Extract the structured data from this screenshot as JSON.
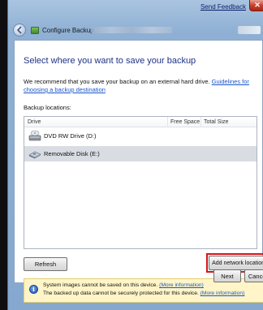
{
  "window": {
    "title": "Configure Backup",
    "send_feedback": "Send Feedback",
    "close_symbol": "✕"
  },
  "page": {
    "heading": "Select where you want to save your backup",
    "recommend_text": "We recommend that you save your backup on an external hard drive. ",
    "recommend_link": "Guidelines for choosing a backup destination",
    "locations_label": "Backup locations:"
  },
  "list": {
    "columns": [
      "Drive",
      "Free Space",
      "Total Size"
    ],
    "rows": [
      {
        "label": "DVD RW Drive (D:)",
        "icon": "dvd-drive-icon"
      },
      {
        "label": "Removable Disk (E:)",
        "icon": "removable-disk-icon",
        "selected": true
      }
    ]
  },
  "buttons": {
    "refresh": "Refresh",
    "add_network": "Add network location...",
    "next": "Next",
    "cancel": "Cancel"
  },
  "info": {
    "line1_text": "System images cannot be saved on this device. ",
    "line1_link": "(More information)",
    "line2_text": "The backed up data cannot be securely protected for this device. ",
    "line2_link": "(More information)"
  },
  "colors": {
    "heading": "#1e3287",
    "link": "#1a56c9",
    "highlight": "#d4141a",
    "info_bg": "#fff5c8",
    "selected_row": "#d9dde3"
  }
}
